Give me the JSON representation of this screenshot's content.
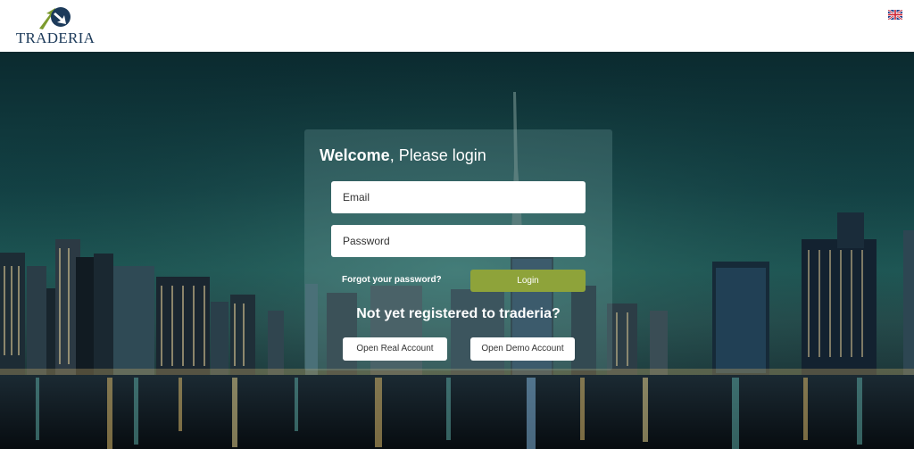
{
  "brand": {
    "name": "TRADERIA",
    "logo_icon": "traderia-arrows-logo"
  },
  "header": {
    "language_icon": "uk-flag-icon"
  },
  "login": {
    "title_bold": "Welcome",
    "title_rest": ", Please login",
    "email_placeholder": "Email",
    "password_placeholder": "Password",
    "forgot_label": "Forgot your password?",
    "login_label": "Login",
    "register_prompt": "Not yet registered to traderia?",
    "real_account_label": "Open Real Account",
    "demo_account_label": "Open Demo Account"
  },
  "colors": {
    "accent": "#8ea33a",
    "brand_navy": "#1c3a5a",
    "brand_green": "#7d9b2e"
  }
}
